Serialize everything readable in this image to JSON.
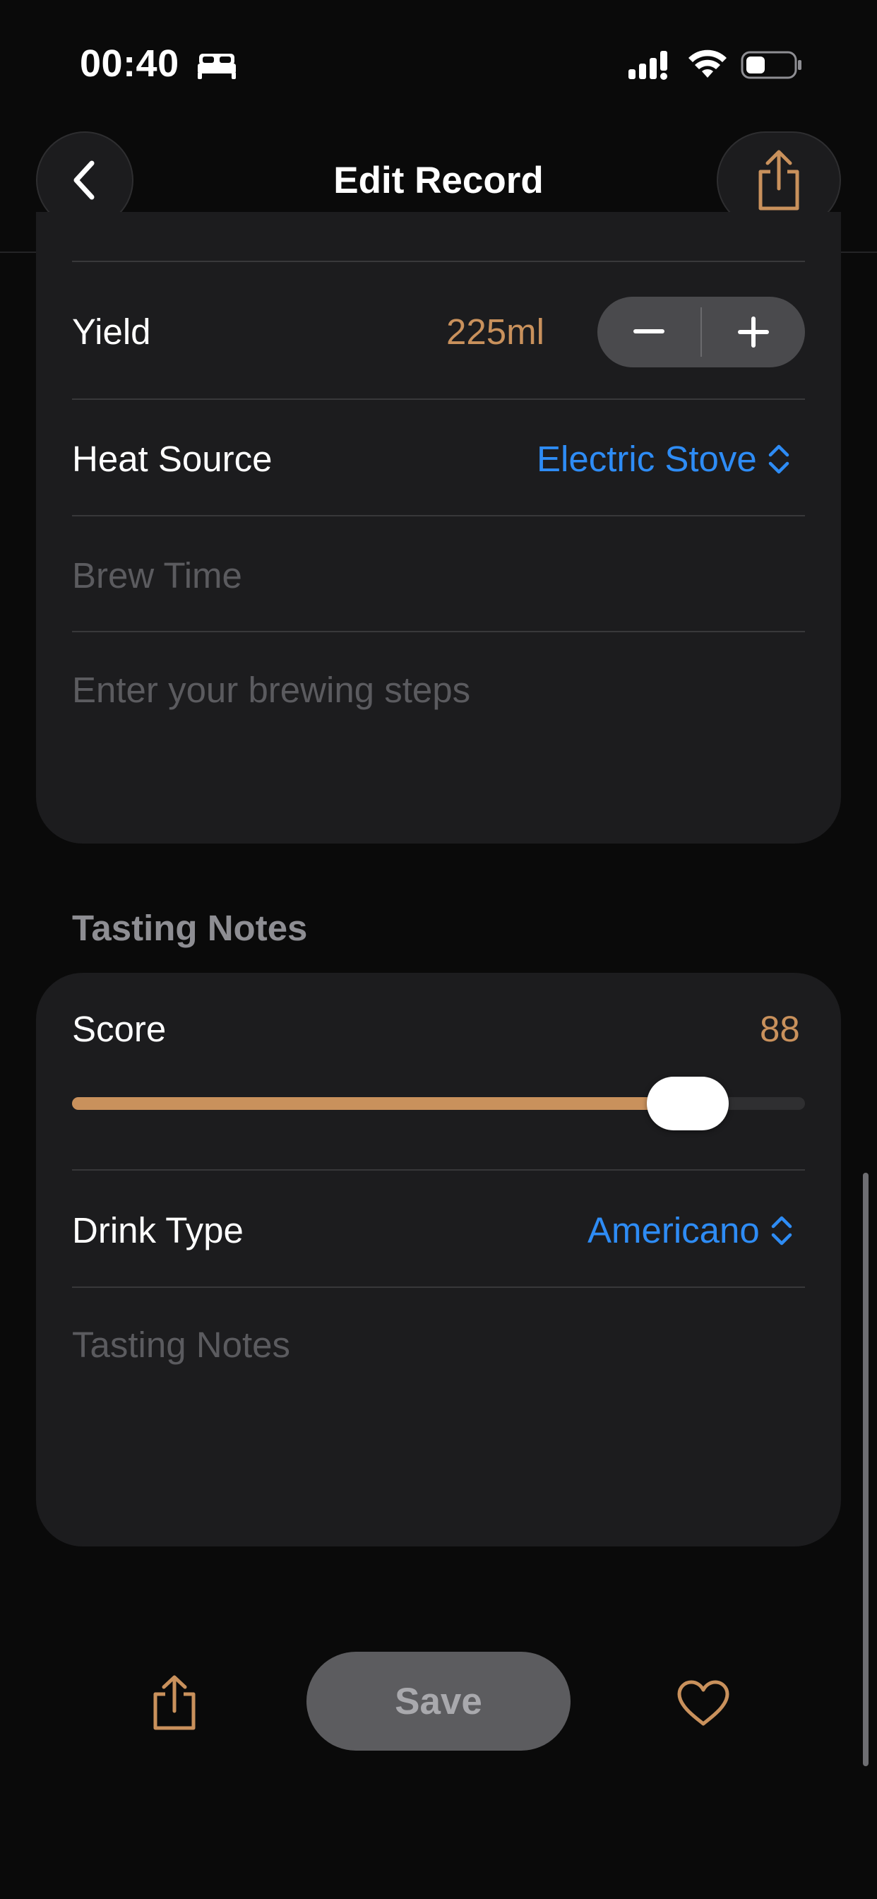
{
  "status_bar": {
    "time": "00:40"
  },
  "nav": {
    "title": "Edit Record"
  },
  "brew": {
    "yield_label": "Yield",
    "yield_value": "225ml",
    "heat_source_label": "Heat Source",
    "heat_source_value": "Electric Stove",
    "brew_time_placeholder": "Brew Time",
    "steps_placeholder": "Enter your brewing steps"
  },
  "tasting": {
    "section_title": "Tasting Notes",
    "score_label": "Score",
    "score_value": "88",
    "slider_fraction": 0.84,
    "drink_type_label": "Drink Type",
    "drink_type_value": "Americano",
    "notes_placeholder": "Tasting Notes"
  },
  "bottom_bar": {
    "save_label": "Save"
  },
  "colors": {
    "accent": "#c9915c",
    "link_blue": "#2e8cf5",
    "background": "#0a0a0a",
    "card": "#1c1c1e"
  },
  "icons": {
    "back": "chevron-left-icon",
    "share": "share-icon",
    "favorite": "heart-icon",
    "picker": "chevron-up-down-icon"
  }
}
